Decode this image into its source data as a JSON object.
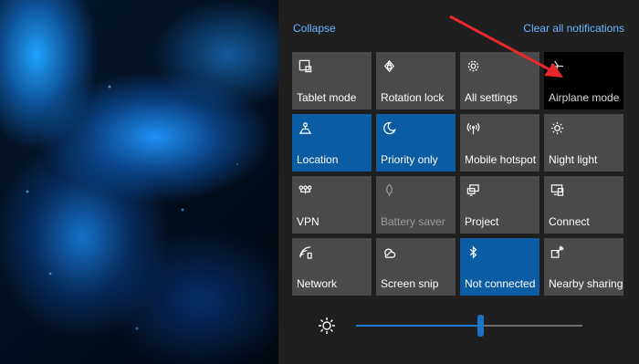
{
  "header": {
    "collapse_label": "Collapse",
    "clear_label": "Clear all notifications"
  },
  "tiles": [
    {
      "label": "Tablet mode",
      "icon": "tablet-mode-icon",
      "state": "off"
    },
    {
      "label": "Rotation lock",
      "icon": "rotation-lock-icon",
      "state": "off"
    },
    {
      "label": "All settings",
      "icon": "gear-icon",
      "state": "off"
    },
    {
      "label": "Airplane mode",
      "icon": "airplane-icon",
      "state": "highlighted"
    },
    {
      "label": "Location",
      "icon": "location-icon",
      "state": "on"
    },
    {
      "label": "Priority only",
      "icon": "moon-icon",
      "state": "on"
    },
    {
      "label": "Mobile hotspot",
      "icon": "hotspot-icon",
      "state": "off"
    },
    {
      "label": "Night light",
      "icon": "night-light-icon",
      "state": "off"
    },
    {
      "label": "VPN",
      "icon": "vpn-icon",
      "state": "off"
    },
    {
      "label": "Battery saver",
      "icon": "battery-saver-icon",
      "state": "disabled"
    },
    {
      "label": "Project",
      "icon": "project-icon",
      "state": "off"
    },
    {
      "label": "Connect",
      "icon": "connect-icon",
      "state": "off"
    },
    {
      "label": "Network",
      "icon": "network-icon",
      "state": "off"
    },
    {
      "label": "Screen snip",
      "icon": "screen-snip-icon",
      "state": "off"
    },
    {
      "label": "Not connected",
      "icon": "bluetooth-icon",
      "state": "on"
    },
    {
      "label": "Nearby sharing",
      "icon": "nearby-sharing-icon",
      "state": "off"
    }
  ],
  "brightness": {
    "icon": "brightness-icon",
    "value_fraction": 0.55
  },
  "colors": {
    "tile_off": "#4a4a4a",
    "tile_on": "#0c5ca3",
    "link": "#6cb4ff",
    "panel": "#1f1f1f",
    "annotation_arrow": "#e8282b"
  }
}
